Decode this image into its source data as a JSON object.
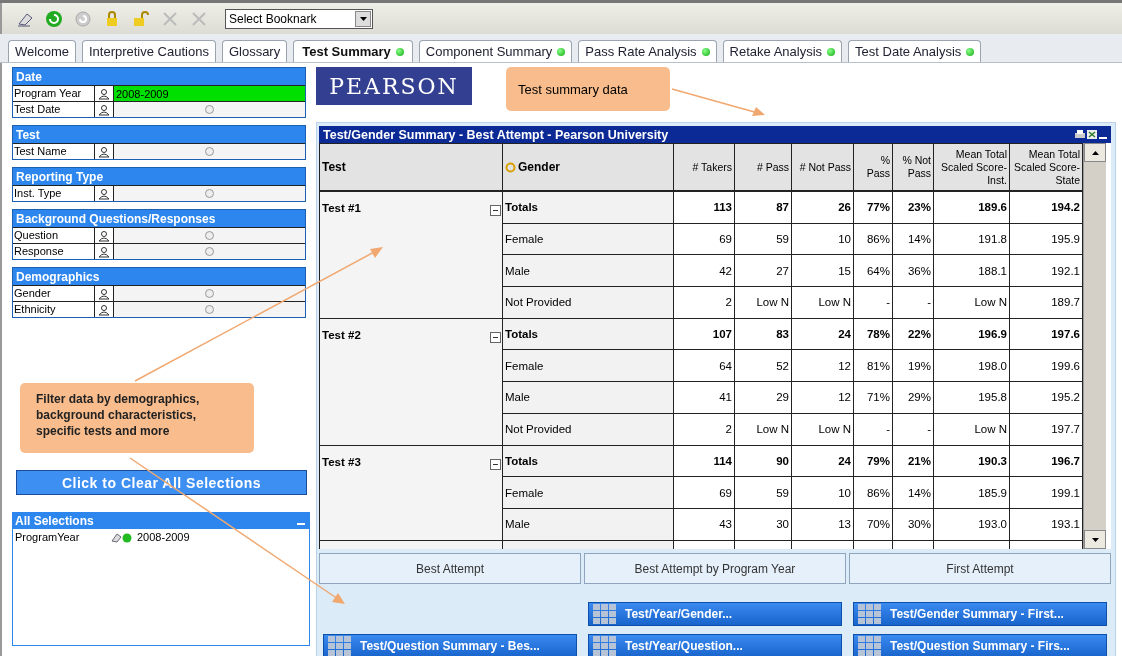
{
  "toolbar": {
    "bookmark": {
      "value": "Select Booknark"
    }
  },
  "tabs": [
    {
      "label": "Welcome",
      "selected": false,
      "indicator": false
    },
    {
      "label": "Interpretive Cautions",
      "selected": false,
      "indicator": false
    },
    {
      "label": "Glossary",
      "selected": false,
      "indicator": false
    },
    {
      "label": "Test Summary",
      "selected": true,
      "indicator": true
    },
    {
      "label": "Component Summary",
      "selected": false,
      "indicator": true
    },
    {
      "label": "Pass Rate Analysis",
      "selected": false,
      "indicator": true
    },
    {
      "label": "Retake Analysis",
      "selected": false,
      "indicator": true
    },
    {
      "label": "Test Date Analysis",
      "selected": false,
      "indicator": true
    }
  ],
  "filters": [
    {
      "title": "Date",
      "rows": [
        {
          "label": "Program Year",
          "value": "2008-2009",
          "selected": true
        },
        {
          "label": "Test Date",
          "selected": false
        }
      ]
    },
    {
      "title": "Test",
      "rows": [
        {
          "label": "Test Name",
          "selected": false
        }
      ]
    },
    {
      "title": "Reporting Type",
      "rows": [
        {
          "label": "Inst. Type",
          "selected": false
        }
      ]
    },
    {
      "title": "Background Questions/Responses",
      "rows": [
        {
          "label": "Question",
          "selected": false
        },
        {
          "label": "Response",
          "selected": false
        }
      ]
    },
    {
      "title": "Demographics",
      "rows": [
        {
          "label": "Gender",
          "selected": false
        },
        {
          "label": "Ethnicity",
          "selected": false
        }
      ]
    }
  ],
  "filter_callout": "Filter data by demographics, background characteristics, specific tests and more",
  "clear_button": "Click to Clear All Selections",
  "all_selections": {
    "title": "All Selections",
    "items": [
      {
        "field": "ProgramYear",
        "value": "2008-2009"
      }
    ]
  },
  "logo": "PEARSON",
  "summary_callout": "Test summary data",
  "table": {
    "title": "Test/Gender Summary - Best Attempt - Pearson University",
    "columns": [
      "Test",
      "Gender",
      "# Takers",
      "# Pass",
      "# Not Pass",
      "% Pass",
      "% Not Pass",
      "Mean Total Scaled Score-Inst.",
      "Mean Total Scaled Score-State"
    ],
    "groups": [
      {
        "test": "Test #1",
        "expanded": true,
        "rows": [
          {
            "kind": "total",
            "gender": "Totals",
            "values": [
              "113",
              "87",
              "26",
              "77%",
              "23%",
              "189.6",
              "194.2"
            ]
          },
          {
            "kind": "detail",
            "gender": "Female",
            "values": [
              "69",
              "59",
              "10",
              "86%",
              "14%",
              "191.8",
              "195.9"
            ]
          },
          {
            "kind": "detail",
            "gender": "Male",
            "values": [
              "42",
              "27",
              "15",
              "64%",
              "36%",
              "188.1",
              "192.1"
            ]
          },
          {
            "kind": "detail",
            "gender": "Not Provided",
            "values": [
              "2",
              "Low N",
              "Low N",
              "-",
              "-",
              "Low N",
              "189.7"
            ]
          }
        ]
      },
      {
        "test": "Test #2",
        "expanded": true,
        "rows": [
          {
            "kind": "total",
            "gender": "Totals",
            "values": [
              "107",
              "83",
              "24",
              "78%",
              "22%",
              "196.9",
              "197.6"
            ]
          },
          {
            "kind": "detail",
            "gender": "Female",
            "values": [
              "64",
              "52",
              "12",
              "81%",
              "19%",
              "198.0",
              "199.6"
            ]
          },
          {
            "kind": "detail",
            "gender": "Male",
            "values": [
              "41",
              "29",
              "12",
              "71%",
              "29%",
              "195.8",
              "195.2"
            ]
          },
          {
            "kind": "detail",
            "gender": "Not Provided",
            "values": [
              "2",
              "Low N",
              "Low N",
              "-",
              "-",
              "Low N",
              "197.7"
            ]
          }
        ]
      },
      {
        "test": "Test #3",
        "expanded": true,
        "rows": [
          {
            "kind": "total",
            "gender": "Totals",
            "values": [
              "114",
              "90",
              "24",
              "79%",
              "21%",
              "190.3",
              "196.7"
            ]
          },
          {
            "kind": "detail",
            "gender": "Female",
            "values": [
              "69",
              "59",
              "10",
              "86%",
              "14%",
              "185.9",
              "199.1"
            ]
          },
          {
            "kind": "detail",
            "gender": "Male",
            "values": [
              "43",
              "30",
              "13",
              "70%",
              "30%",
              "193.0",
              "193.1"
            ]
          }
        ]
      }
    ]
  },
  "report_sections": [
    {
      "title": "Best Attempt",
      "buttons": [
        "Test/Question Summary - Bes..."
      ]
    },
    {
      "title": "Best Attempt by Program Year",
      "buttons": [
        "Test/Year/Gender...",
        "Test/Year/Question..."
      ]
    },
    {
      "title": "First Attempt",
      "buttons": [
        "Test/Gender Summary - First...",
        "Test/Question Summary - Firs..."
      ]
    }
  ]
}
